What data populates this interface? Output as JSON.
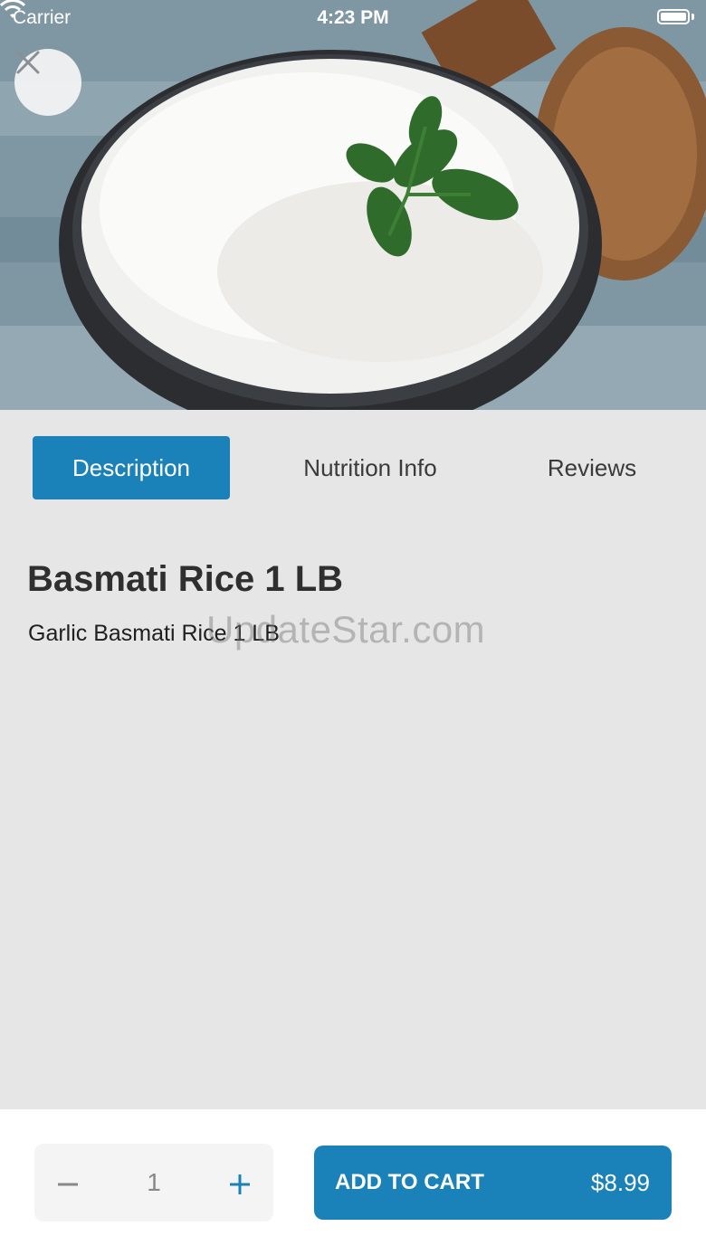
{
  "status_bar": {
    "carrier": "Carrier",
    "time": "4:23 PM",
    "wifi_icon": "wifi-icon",
    "battery_icon": "battery-icon"
  },
  "hero": {
    "close_icon": "close-icon"
  },
  "tabs": [
    {
      "label": "Description",
      "active": true
    },
    {
      "label": "Nutrition Info",
      "active": false
    },
    {
      "label": "Reviews",
      "active": false
    }
  ],
  "product": {
    "title": "Basmati Rice 1 LB",
    "description": "Garlic Basmati Rice 1 LB"
  },
  "watermark": "UpdateStar.com",
  "cart": {
    "quantity": "1",
    "minus_icon": "minus-icon",
    "plus_icon": "plus-icon",
    "add_label": "ADD TO CART",
    "price": "$8.99"
  },
  "colors": {
    "accent": "#1a82b8",
    "page_bg": "#e6e6e6",
    "bottom_bg": "#ffffff"
  }
}
